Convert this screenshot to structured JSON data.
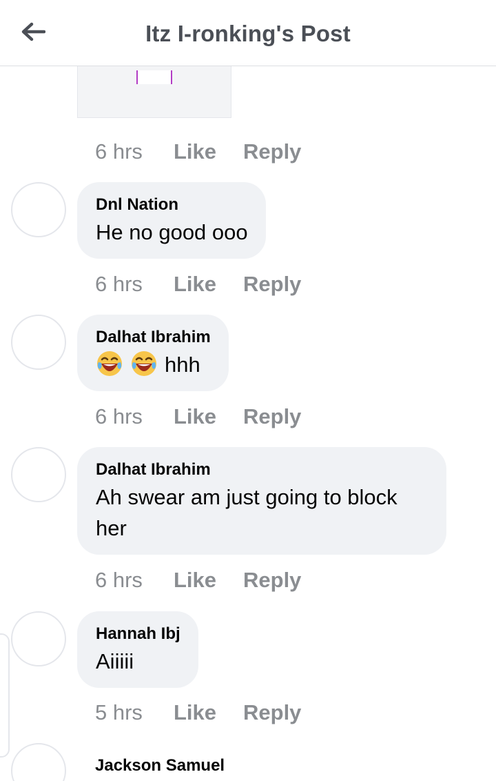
{
  "header": {
    "title": "Itz I-ronking's Post"
  },
  "top_actions": {
    "time": "6 hrs",
    "like": "Like",
    "reply": "Reply"
  },
  "comments": [
    {
      "author": "Dnl Nation",
      "text": "He no good ooo",
      "time": "6 hrs",
      "like": "Like",
      "reply": "Reply"
    },
    {
      "author": "Dalhat Ibrahim",
      "text": "hhh",
      "emoji": "face-with-tears-of-joy-icon",
      "time": "6 hrs",
      "like": "Like",
      "reply": "Reply"
    },
    {
      "author": "Dalhat Ibrahim",
      "text_line1": "Ah swear am just going to block",
      "text_line2": "her",
      "time": "6 hrs",
      "like": "Like",
      "reply": "Reply"
    },
    {
      "author": "Hannah Ibj",
      "text": "Aiiiii",
      "time": "5 hrs",
      "like": "Like",
      "reply": "Reply"
    }
  ],
  "last_comment": {
    "author": "Jackson Samuel"
  },
  "colors": {
    "bubble": "#f0f2f5",
    "meta_text": "#8a8d91",
    "title_text": "#4b4f56"
  }
}
